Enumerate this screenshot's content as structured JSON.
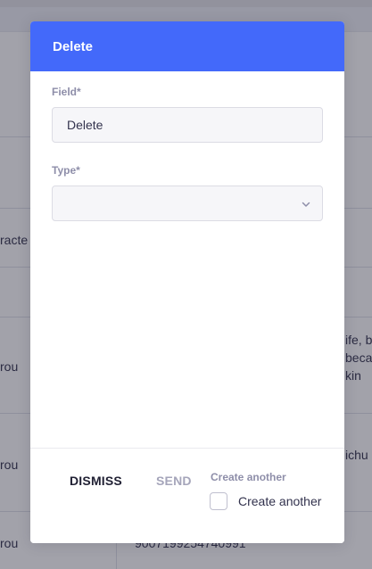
{
  "background": {
    "snippets": [
      {
        "id": "racte",
        "text": "racte"
      },
      {
        "id": "rou1",
        "text": "rou"
      },
      {
        "id": "ife",
        "text": "ife, b"
      },
      {
        "id": "beca",
        "text": "beca"
      },
      {
        "id": "kin",
        "text": "kin"
      },
      {
        "id": "rou2",
        "text": "rou"
      },
      {
        "id": "ichu",
        "text": "ichu"
      },
      {
        "id": "rou3",
        "text": "rou"
      },
      {
        "id": "number",
        "text": "9007199254740991"
      }
    ]
  },
  "modal": {
    "title": "Delete",
    "field": {
      "label": "Field*",
      "value": "Delete"
    },
    "type": {
      "label": "Type*",
      "selected": ""
    },
    "footer": {
      "dismiss_label": "DISMISS",
      "send_label": "SEND",
      "create_another_heading": "Create another",
      "create_another_checkbox_label": "Create another",
      "create_another_checked": false
    }
  },
  "colors": {
    "header_blue": "#4369fa",
    "overlay": "#212134",
    "muted_label": "#8e8ea9",
    "disabled_button": "#a5a5ba"
  }
}
